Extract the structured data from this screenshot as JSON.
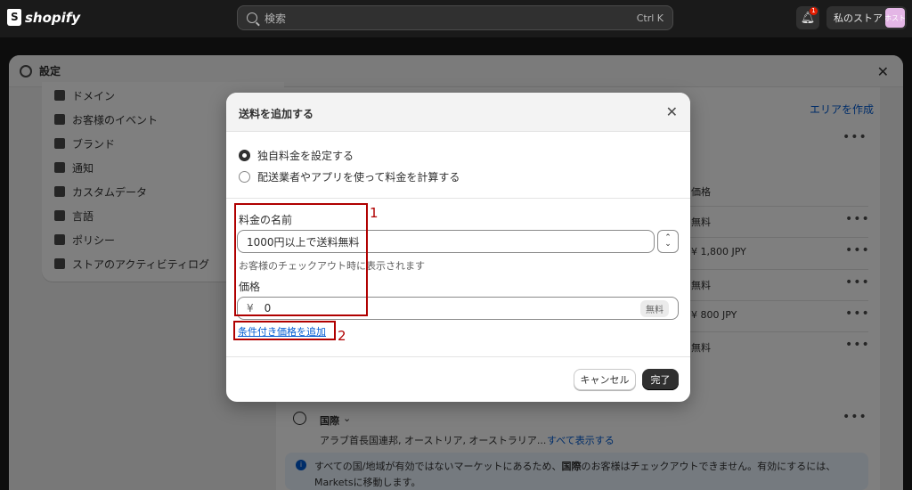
{
  "topbar": {
    "logo": "shopify",
    "search_placeholder": "検索",
    "search_shortcut": "Ctrl K",
    "notification_count": "1",
    "store_name": "私のストア",
    "avatar_text": "ホスト"
  },
  "settings": {
    "title": "設定",
    "sidebar": [
      {
        "label": "ドメイン"
      },
      {
        "label": "お客様のイベント"
      },
      {
        "label": "ブランド"
      },
      {
        "label": "通知"
      },
      {
        "label": "カスタムデータ"
      },
      {
        "label": "言語"
      },
      {
        "label": "ポリシー"
      },
      {
        "label": "ストアのアクティビティログ"
      }
    ],
    "background": {
      "create_area_link": "エリアを作成",
      "price_header": "価格",
      "rows": [
        "無料",
        "¥ 1,800 JPY",
        "無料",
        "¥ 800 JPY",
        "無料"
      ],
      "international_title": "国際",
      "international_countries": "アラブ首長国連邦, オーストリア, オーストラリア...",
      "show_all_link": "すべて表示する",
      "info_text_1": "すべての国/地域が有効ではないマーケットにあるため、",
      "info_text_bold": "国際",
      "info_text_2": "のお客様はチェックアウトできません。有効にするには、",
      "info_text_3": "Marketsに移動します。"
    }
  },
  "modal": {
    "title": "送料を追加する",
    "radio_custom": "独自料金を設定する",
    "radio_carrier": "配送業者やアプリを使って料金を計算する",
    "rate_name_label": "料金の名前",
    "rate_name_value": "1000円以上で送料無料",
    "help_text": "お客様のチェックアウト時に表示されます",
    "price_label": "価格",
    "currency": "¥",
    "price_value": "0",
    "free_badge": "無料",
    "add_conditional_link": "条件付き価格を追加",
    "cancel_button": "キャンセル",
    "done_button": "完了"
  },
  "annotations": {
    "box1_number": "1",
    "box2_number": "2"
  }
}
